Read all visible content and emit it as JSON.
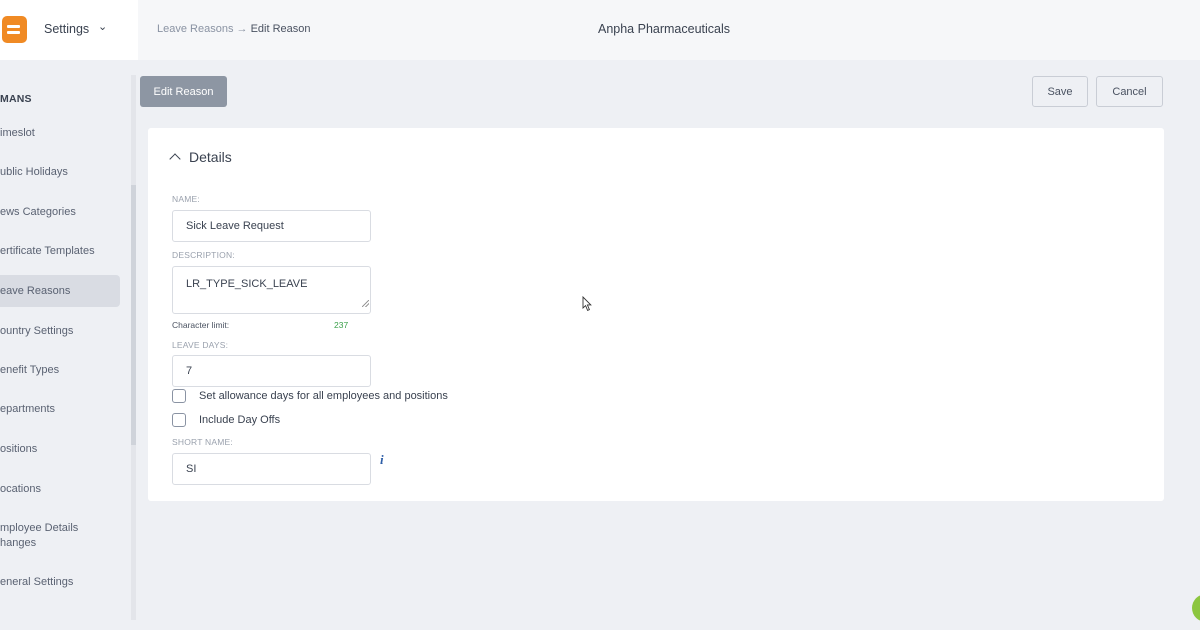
{
  "header": {
    "module_label": "Settings",
    "breadcrumb_parent": "Leave Reasons",
    "breadcrumb_separator": "→",
    "breadcrumb_current": "Edit Reason",
    "org_name": "Anpha Pharmaceuticals",
    "brand_color": "#f08a24"
  },
  "sidebar": {
    "section": "MANS",
    "items": [
      {
        "label": "imeslot"
      },
      {
        "label": "ublic Holidays"
      },
      {
        "label": "ews Categories"
      },
      {
        "label": "ertificate Templates"
      },
      {
        "label": "eave Reasons",
        "active": true
      },
      {
        "label": "ountry Settings"
      },
      {
        "label": "enefit Types"
      },
      {
        "label": "epartments"
      },
      {
        "label": "ositions"
      },
      {
        "label": "ocations"
      },
      {
        "label": "mployee Details\nhanges"
      },
      {
        "label": "eneral Settings"
      }
    ]
  },
  "toolbar": {
    "page_tag": "Edit Reason",
    "save_label": "Save",
    "cancel_label": "Cancel"
  },
  "form": {
    "section_title": "Details",
    "name_label": "NAME:",
    "name_value": "Sick Leave Request",
    "description_label": "DESCRIPTION:",
    "description_value": "LR_TYPE_SICK_LEAVE",
    "char_limit_label": "Character limit:",
    "char_limit_value": "237",
    "leave_days_label": "LEAVE DAYS:",
    "leave_days_value": "7",
    "allowance_checkbox_label": "Set allowance days for all employees and positions",
    "allowance_checked": false,
    "day_offs_checkbox_label": "Include Day Offs",
    "day_offs_checked": false,
    "short_name_label": "SHORT NAME:",
    "short_name_value": "SI",
    "info_glyph": "i"
  }
}
